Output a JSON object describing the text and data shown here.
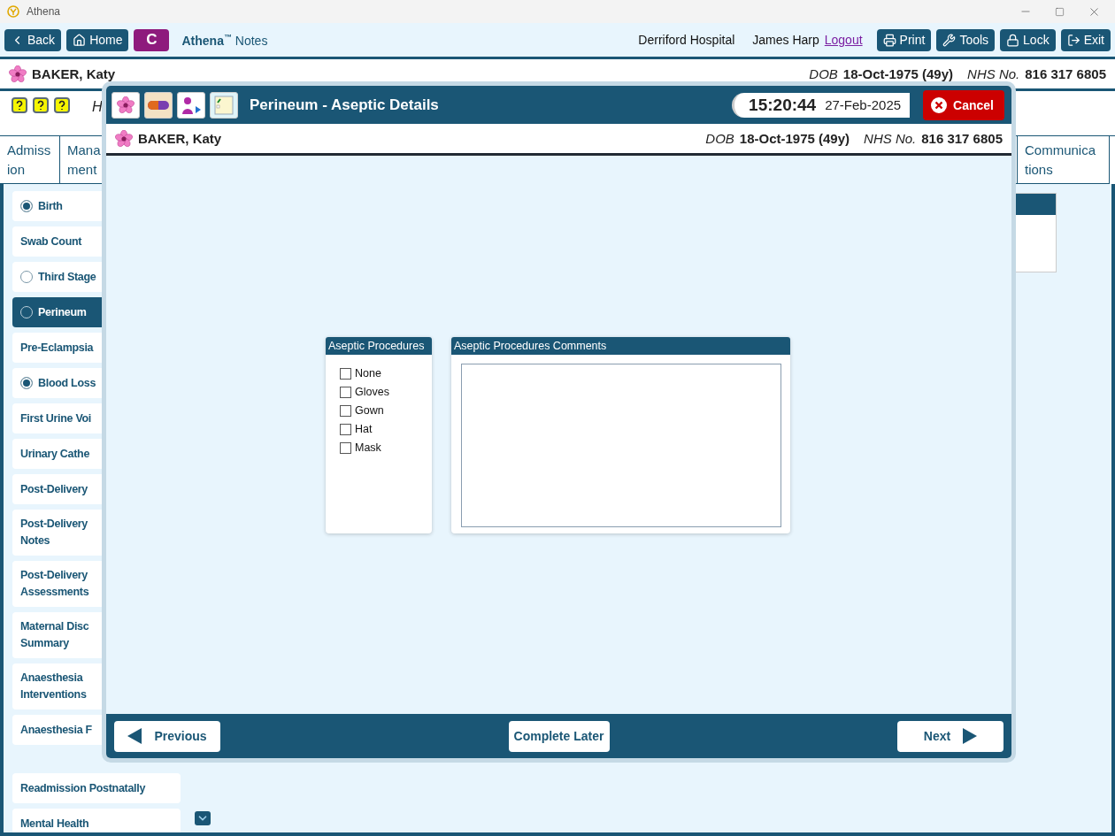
{
  "window": {
    "title": "Athena"
  },
  "toolbar": {
    "back": "Back",
    "home": "Home",
    "badge": "C",
    "app_name": "Athena",
    "app_mark": "™",
    "app_section": "Notes",
    "location": "Derriford Hospital",
    "user": "James Harp",
    "logout": "Logout",
    "actions": [
      {
        "kind": "print",
        "label": "Print"
      },
      {
        "kind": "tools",
        "label": "Tools"
      },
      {
        "kind": "lock",
        "label": "Lock"
      },
      {
        "kind": "exit",
        "label": "Exit"
      }
    ]
  },
  "patient": {
    "name": "BAKER, Katy",
    "dob_label": "DOB",
    "dob": "18-Oct-1975 (49y)",
    "nhs_label": "NHS No.",
    "nhs": "816 317 6805"
  },
  "info_text": "H",
  "tabs": [
    {
      "lines": [
        "Admiss",
        "ion"
      ]
    },
    {
      "lines": [
        "Mana",
        "ment"
      ]
    },
    {
      "lines": [
        "Communica",
        "tions"
      ]
    }
  ],
  "sidebar": {
    "items": [
      {
        "checked": true,
        "selected": false,
        "lines": [
          "Birth"
        ]
      },
      {
        "selected": false,
        "lines": [
          "Swab Count"
        ]
      },
      {
        "checked": false,
        "selected": false,
        "lines": [
          "Third Stage"
        ]
      },
      {
        "checked": false,
        "selected": true,
        "lines": [
          "Perineum"
        ]
      },
      {
        "selected": false,
        "lines": [
          "Pre-Eclampsia"
        ]
      },
      {
        "checked": true,
        "selected": false,
        "lines": [
          "Blood Loss"
        ]
      },
      {
        "selected": false,
        "lines": [
          "First Urine Voi"
        ]
      },
      {
        "selected": false,
        "lines": [
          "Urinary Cathe"
        ]
      },
      {
        "selected": false,
        "lines": [
          "Post-Delivery"
        ]
      },
      {
        "selected": false,
        "lines": [
          "Post-Delivery",
          "Notes"
        ]
      },
      {
        "selected": false,
        "lines": [
          "Post-Delivery",
          "Assessments"
        ]
      },
      {
        "selected": false,
        "lines": [
          "Maternal Disc",
          "Summary"
        ]
      },
      {
        "selected": false,
        "lines": [
          "Anaesthesia",
          "Interventions"
        ]
      },
      {
        "selected": false,
        "lines": [
          "Anaesthesia F"
        ]
      }
    ],
    "more_items": [
      {
        "selected": false,
        "lines": [
          "Readmission Postnatally"
        ]
      },
      {
        "selected": false,
        "lines": [
          "Mental Health"
        ]
      }
    ]
  },
  "dialog": {
    "title": "Perineum - Aseptic Details",
    "time": "15:20:44",
    "date": "27-Feb-2025",
    "cancel": "Cancel",
    "patient": {
      "name": "BAKER, Katy",
      "dob_label": "DOB",
      "dob": "18-Oct-1975 (49y)",
      "nhs_label": "NHS No.",
      "nhs": "816 317 6805"
    },
    "procedures": {
      "title": "Aseptic Procedures",
      "options": [
        {
          "label": "None",
          "checked": false
        },
        {
          "label": "Gloves",
          "checked": false
        },
        {
          "label": "Gown",
          "checked": false
        },
        {
          "label": "Hat",
          "checked": false
        },
        {
          "label": "Mask",
          "checked": false
        }
      ]
    },
    "comments": {
      "title": "Aseptic Procedures Comments"
    },
    "previous": "Previous",
    "complete_later": "Complete Later",
    "next": "Next"
  }
}
